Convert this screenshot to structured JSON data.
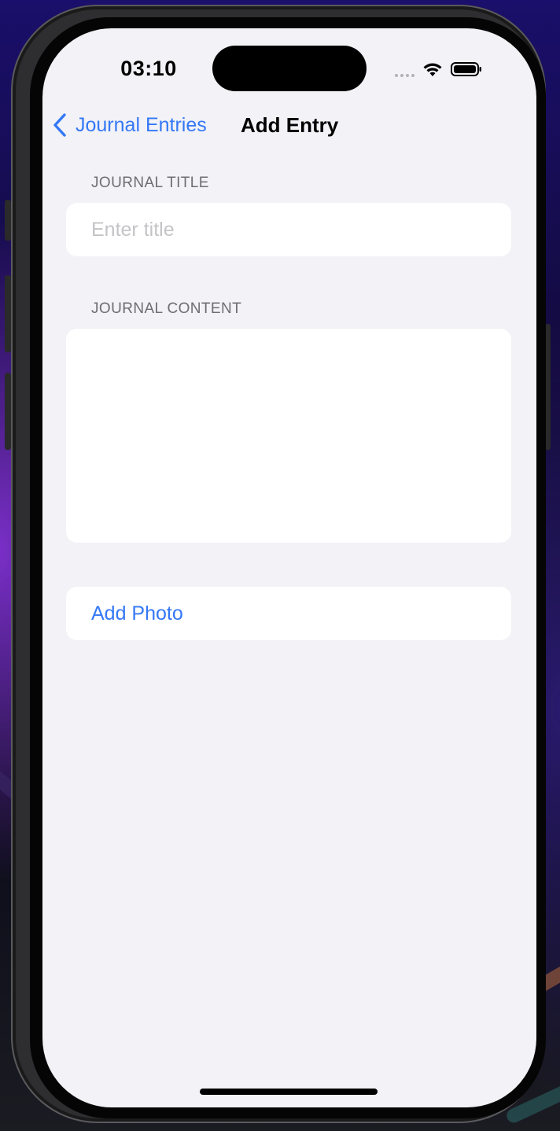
{
  "status_bar": {
    "time": "03:10"
  },
  "nav": {
    "back_label": "Journal Entries",
    "title": "Add Entry",
    "accent_color": "#3478f6"
  },
  "form": {
    "title_section_header": "JOURNAL TITLE",
    "title_placeholder": "Enter title",
    "title_value": "",
    "content_section_header": "JOURNAL CONTENT",
    "content_value": "",
    "add_photo_label": "Add Photo"
  },
  "icons": {
    "back": "chevron-left-icon",
    "signal": "cellular-signal-icon",
    "wifi": "wifi-icon",
    "battery": "battery-icon"
  }
}
